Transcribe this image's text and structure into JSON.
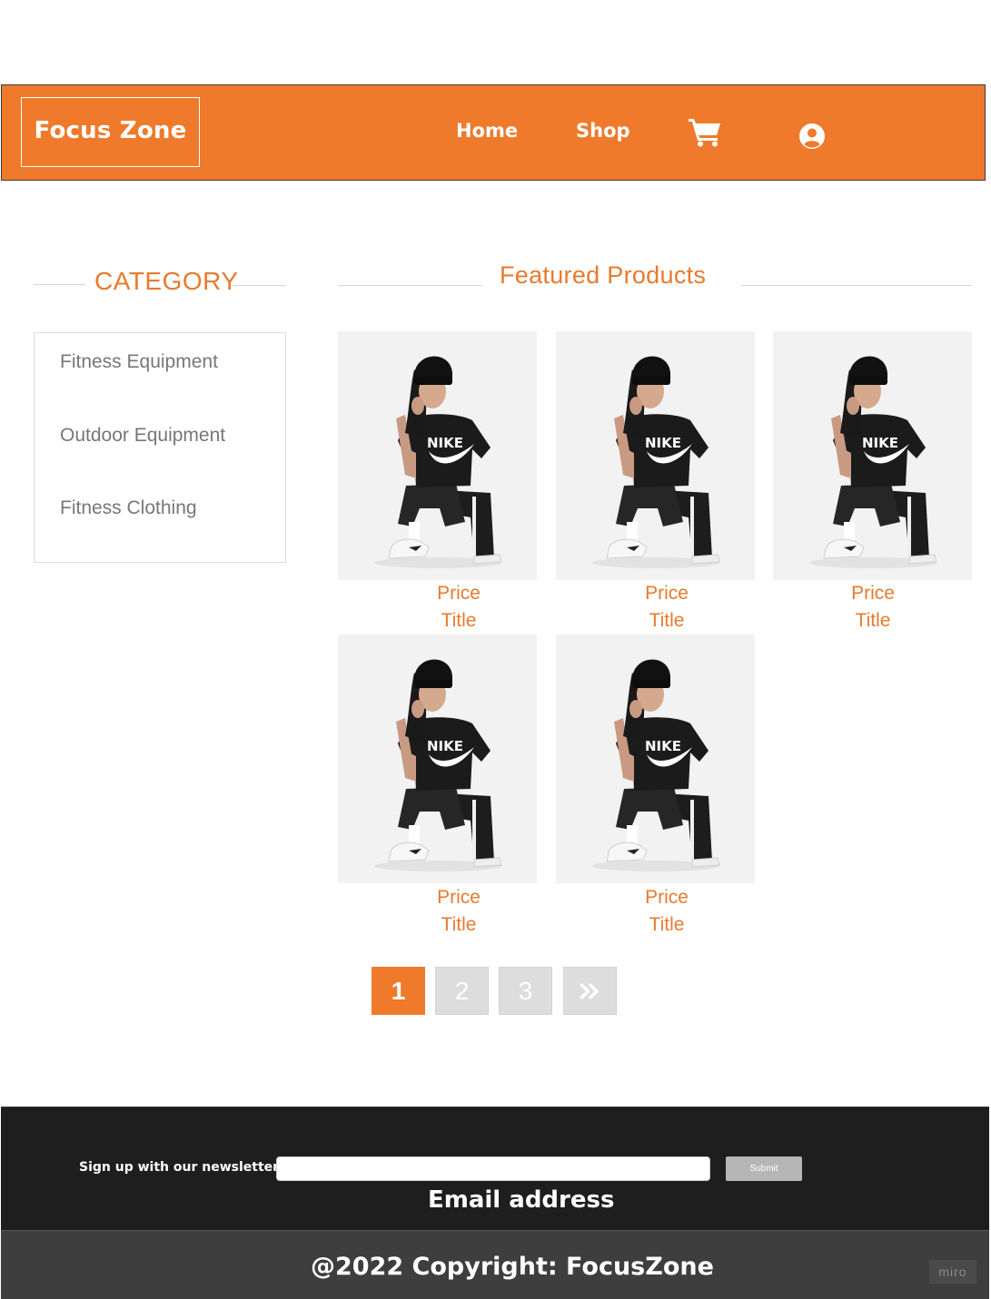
{
  "header": {
    "logo": "Focus Zone",
    "nav": [
      {
        "label": "Home"
      },
      {
        "label": "Shop"
      }
    ],
    "icons": [
      "cart-icon",
      "user-icon"
    ],
    "brand_color": "#ef7a2b"
  },
  "sidebar": {
    "heading": "CATEGORY",
    "items": [
      {
        "label": "Fitness Equipment"
      },
      {
        "label": "Outdoor Equipment"
      },
      {
        "label": "Fitness Clothing"
      }
    ]
  },
  "main": {
    "heading": "Featured Products",
    "products": [
      {
        "price": "Price",
        "title": "Title"
      },
      {
        "price": "Price",
        "title": "Title"
      },
      {
        "price": "Price",
        "title": "Title"
      },
      {
        "price": "Price",
        "title": "Title"
      },
      {
        "price": "Price",
        "title": "Title"
      }
    ]
  },
  "pagination": {
    "pages": [
      "1",
      "2",
      "3"
    ],
    "active": "1",
    "next_icon": "double-chevron-right-icon"
  },
  "footer": {
    "newsletter_label": "Sign up with our newsletter",
    "submit_label": "Submit",
    "email_label": "Email address",
    "copyright": "@2022 Copyright: FocusZone",
    "badge": "miro"
  }
}
